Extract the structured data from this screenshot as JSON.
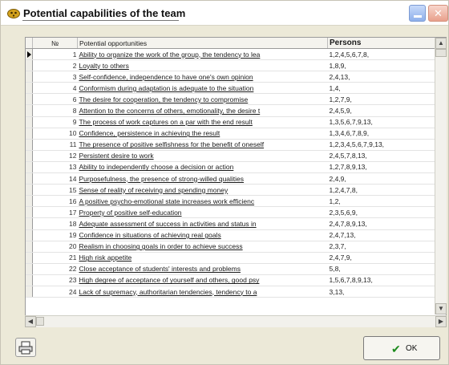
{
  "window": {
    "title": "Potential capabilities of the team"
  },
  "grid": {
    "columns": {
      "num": "№",
      "opportunity": "Potential opportunities",
      "persons": "Persons"
    },
    "rows": [
      {
        "n": "1",
        "opportunity": "Ability to organize the work of the group, the tendency to lea",
        "persons": "1,2,4,5,6,7,8,"
      },
      {
        "n": "2",
        "opportunity": "Loyalty to others",
        "persons": "1,8,9,"
      },
      {
        "n": "3",
        "opportunity": "Self-confidence, independence to have one's own opinion",
        "persons": "2,4,13,"
      },
      {
        "n": "4",
        "opportunity": "Conformism during adaptation is adequate to the situation",
        "persons": "1,4,"
      },
      {
        "n": "6",
        "opportunity": "The desire for cooperation, the tendency to compromise",
        "persons": "1,2,7,9,"
      },
      {
        "n": "8",
        "opportunity": "Attention to the concerns of others, emotionality, the desire t",
        "persons": "2,4,5,9,"
      },
      {
        "n": "9",
        "opportunity": "The process of work captures on a par with the end result",
        "persons": "1,3,5,6,7,9,13,"
      },
      {
        "n": "10",
        "opportunity": "Confidence, persistence in achieving the result",
        "persons": "1,3,4,6,7,8,9,"
      },
      {
        "n": "11",
        "opportunity": "The presence of positive selfishness for the benefit of oneself",
        "persons": "1,2,3,4,5,6,7,9,13,"
      },
      {
        "n": "12",
        "opportunity": "Persistent desire to work",
        "persons": "2,4,5,7,8,13,"
      },
      {
        "n": "13",
        "opportunity": "Ability to independently choose a decision or action",
        "persons": "1,2,7,8,9,13,"
      },
      {
        "n": "14",
        "opportunity": "Purposefulness, the presence of strong-willed qualities",
        "persons": "2,4,9,"
      },
      {
        "n": "15",
        "opportunity": "Sense of reality of receiving and spending money",
        "persons": "1,2,4,7,8,"
      },
      {
        "n": "16",
        "opportunity": "A positive psycho-emotional state increases work efficienc",
        "persons": "1,2,"
      },
      {
        "n": "17",
        "opportunity": "Property of positive self-education",
        "persons": "2,3,5,6,9,"
      },
      {
        "n": "18",
        "opportunity": "Adequate assessment of success in activities and status in",
        "persons": "2,4,7,8,9,13,"
      },
      {
        "n": "19",
        "opportunity": "Confidence in situations of achieving real goals",
        "persons": "2,4,7,13,"
      },
      {
        "n": "20",
        "opportunity": "Realism in choosing goals in order to achieve success",
        "persons": "2,3,7,"
      },
      {
        "n": "21",
        "opportunity": "High risk appetite",
        "persons": "2,4,7,9,"
      },
      {
        "n": "22",
        "opportunity": "Close acceptance of students' interests and problems",
        "persons": "5,8,"
      },
      {
        "n": "23",
        "opportunity": "High degree of acceptance of yourself and others, good psy",
        "persons": "1,5,6,7,8,9,13,"
      },
      {
        "n": "24",
        "opportunity": "Lack of supremacy, authoritarian tendencies, tendency to a",
        "persons": "3,13,"
      }
    ]
  },
  "buttons": {
    "ok_label": "OK"
  },
  "icons": {
    "title_icon": "app-folder-icon",
    "print": "printer-icon",
    "ok": "checkmark-icon"
  }
}
